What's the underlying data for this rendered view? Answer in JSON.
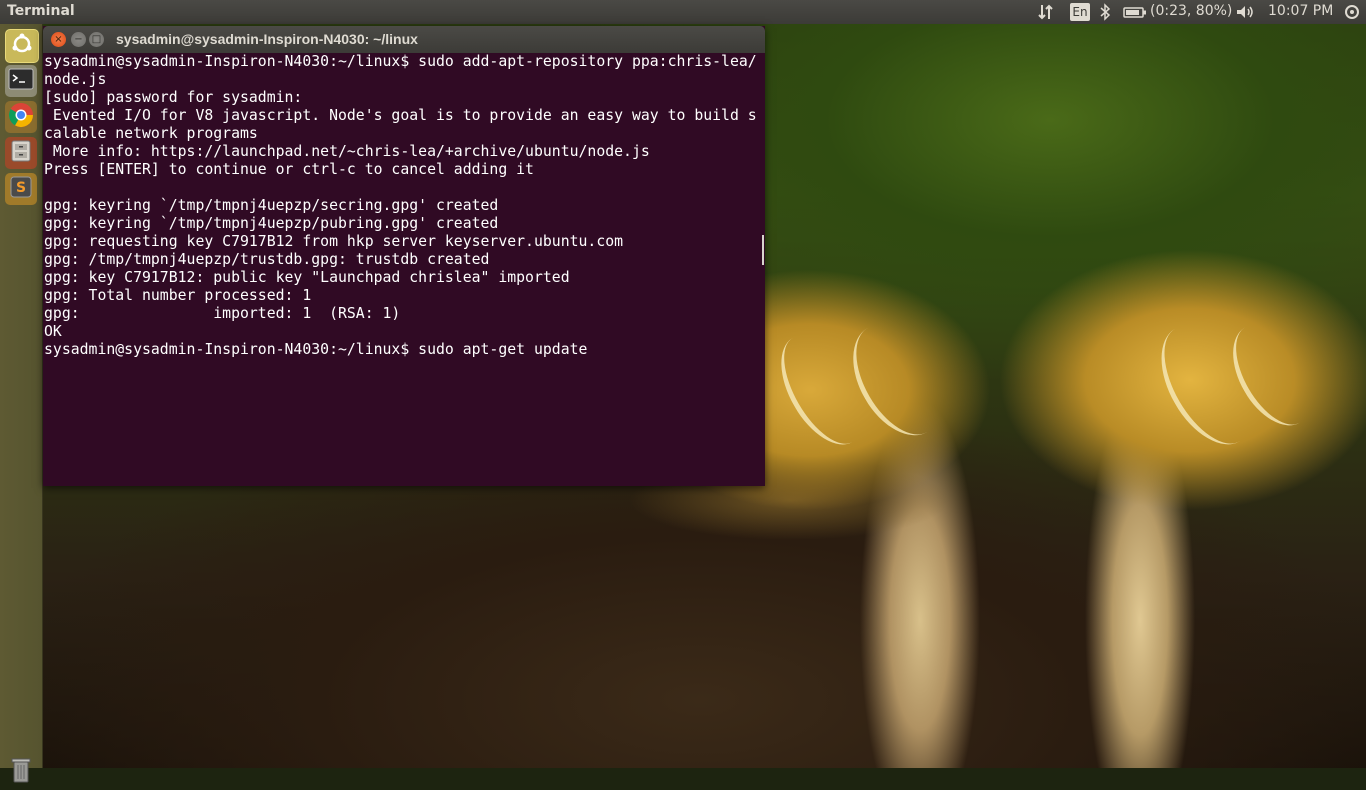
{
  "panel": {
    "app_title": "Terminal",
    "network_icon": "network-updown-icon",
    "keyboard_layout": "En",
    "bluetooth_icon": "bluetooth-icon",
    "battery_status": "(0:23, 80%)",
    "volume_icon": "volume-icon",
    "clock": "10:07 PM",
    "settings_icon": "gear-power-icon"
  },
  "launcher": {
    "items": [
      {
        "name": "dash-home",
        "icon": "ubuntu-logo-icon"
      },
      {
        "name": "terminal",
        "icon": "terminal-icon"
      },
      {
        "name": "chromium",
        "icon": "chrome-icon"
      },
      {
        "name": "files",
        "icon": "file-cabinet-icon"
      },
      {
        "name": "sublime-text",
        "icon": "sublime-text-icon"
      }
    ],
    "trash_icon": "trash-icon"
  },
  "window": {
    "title": "sysadmin@sysadmin-Inspiron-N4030: ~/linux",
    "close_glyph": "×",
    "minimize_glyph": "−",
    "maximize_glyph": "□"
  },
  "terminal": {
    "lines": [
      "sysadmin@sysadmin-Inspiron-N4030:~/linux$ sudo add-apt-repository ppa:chris-lea/",
      "node.js",
      "[sudo] password for sysadmin:",
      " Evented I/O for V8 javascript. Node's goal is to provide an easy way to build s",
      "calable network programs",
      " More info: https://launchpad.net/~chris-lea/+archive/ubuntu/node.js",
      "Press [ENTER] to continue or ctrl-c to cancel adding it",
      "",
      "gpg: keyring `/tmp/tmpnj4uepzp/secring.gpg' created",
      "gpg: keyring `/tmp/tmpnj4uepzp/pubring.gpg' created",
      "gpg: requesting key C7917B12 from hkp server keyserver.ubuntu.com",
      "gpg: /tmp/tmpnj4uepzp/trustdb.gpg: trustdb created",
      "gpg: key C7917B12: public key \"Launchpad chrislea\" imported",
      "gpg: Total number processed: 1",
      "gpg:               imported: 1  (RSA: 1)",
      "OK",
      "sysadmin@sysadmin-Inspiron-N4030:~/linux$ sudo apt-get update"
    ]
  },
  "colors": {
    "terminal_bg": "#300a24",
    "panel_bg": "#3c3b37",
    "close_button": "#df4a16"
  }
}
